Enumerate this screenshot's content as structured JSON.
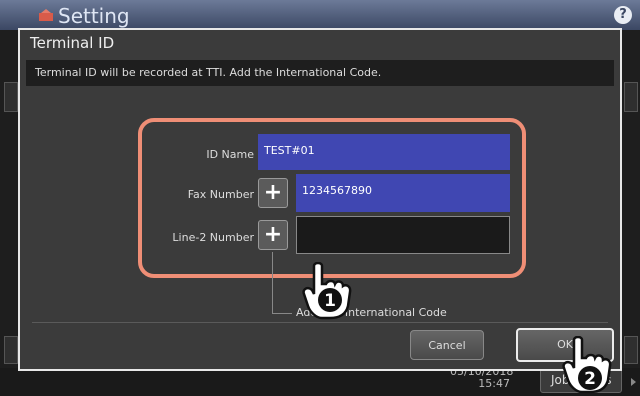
{
  "app": {
    "title": "Setting",
    "help_label": "?",
    "clock_date": "05/10/2018",
    "clock_time": "15:47",
    "job_button": "Job Status"
  },
  "dialog": {
    "title": "Terminal ID",
    "message": "Terminal ID will be recorded at TTI. Add the International Code.",
    "id_name_label": "ID Name",
    "id_name_value": "TEST#01",
    "fax_label": "Fax Number",
    "fax_value": "1234567890",
    "line2_label": "Line-2 Number",
    "line2_value": "",
    "plus_label": "+",
    "add_code_text": "Add “+” International Code",
    "cancel_label": "Cancel",
    "ok_label": "OK"
  },
  "callouts": {
    "step1": "1",
    "step2": "2"
  },
  "colors": {
    "highlight_frame": "#ef8e76",
    "selected_field": "#4047b2"
  }
}
